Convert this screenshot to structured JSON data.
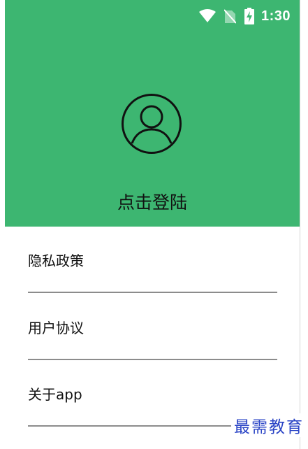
{
  "status_bar": {
    "time": "1:30",
    "icons": [
      "wifi-icon",
      "no-sim-icon",
      "battery-charging-icon"
    ]
  },
  "header": {
    "background_color": "#3db671",
    "avatar_icon": "user-circle-icon",
    "login_label": "点击登陆"
  },
  "menu": {
    "items": [
      {
        "label": "隐私政策"
      },
      {
        "label": "用户协议"
      },
      {
        "label": "关于app"
      }
    ]
  },
  "watermark": "最需教育"
}
